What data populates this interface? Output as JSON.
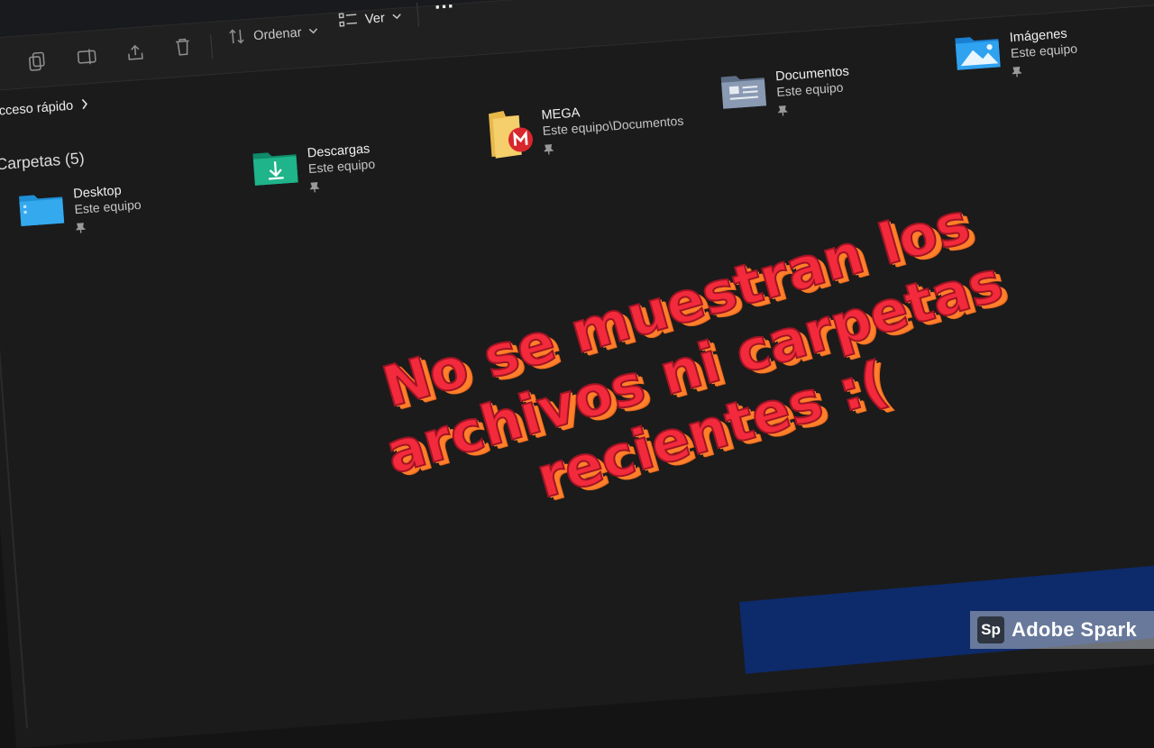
{
  "toolbar": {
    "sort_label": "Ordenar",
    "view_label": "Ver",
    "more_label": "…"
  },
  "breadcrumb": {
    "label": "Acceso rápido"
  },
  "folders_section": {
    "title": "Carpetas (5)"
  },
  "folders": [
    {
      "name": "Desktop",
      "location": "Este equipo",
      "icon": "desktop-folder-icon"
    },
    {
      "name": "Descargas",
      "location": "Este equipo",
      "icon": "downloads-folder-icon"
    },
    {
      "name": "MEGA",
      "location": "Este equipo\\Documentos",
      "icon": "mega-folder-icon"
    },
    {
      "name": "Documentos",
      "location": "Este equipo",
      "icon": "documents-folder-icon"
    },
    {
      "name": "Imágenes",
      "location": "Este equipo",
      "icon": "pictures-folder-icon"
    }
  ],
  "caption": {
    "line1": "No se muestran los",
    "line2": "archivos ni carpetas",
    "line3": "recientes :("
  },
  "watermark": {
    "logo": "Sp",
    "text": "Adobe Spark"
  },
  "colors": {
    "caption_fill": "#f22a3c",
    "caption_shadow": "#ff7f2a",
    "background": "#1b1b1b"
  }
}
